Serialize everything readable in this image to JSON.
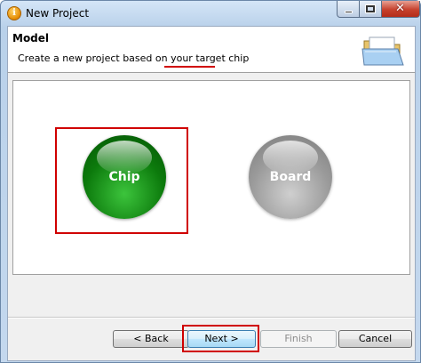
{
  "window": {
    "title": "New Project"
  },
  "header": {
    "title": "Model",
    "description": "Create a new project based on your target chip"
  },
  "options": [
    {
      "label": "Chip",
      "selected": true,
      "color": "#0c7a0c"
    },
    {
      "label": "Board",
      "selected": false,
      "color": "#9a9a9a"
    }
  ],
  "buttons": {
    "back": "< Back",
    "next": "Next >",
    "finish": "Finish",
    "cancel": "Cancel"
  },
  "icons": {
    "app": "eclipse-app-icon",
    "header": "open-folder-icon",
    "close": "✕"
  },
  "annotation_color": "#d00000"
}
